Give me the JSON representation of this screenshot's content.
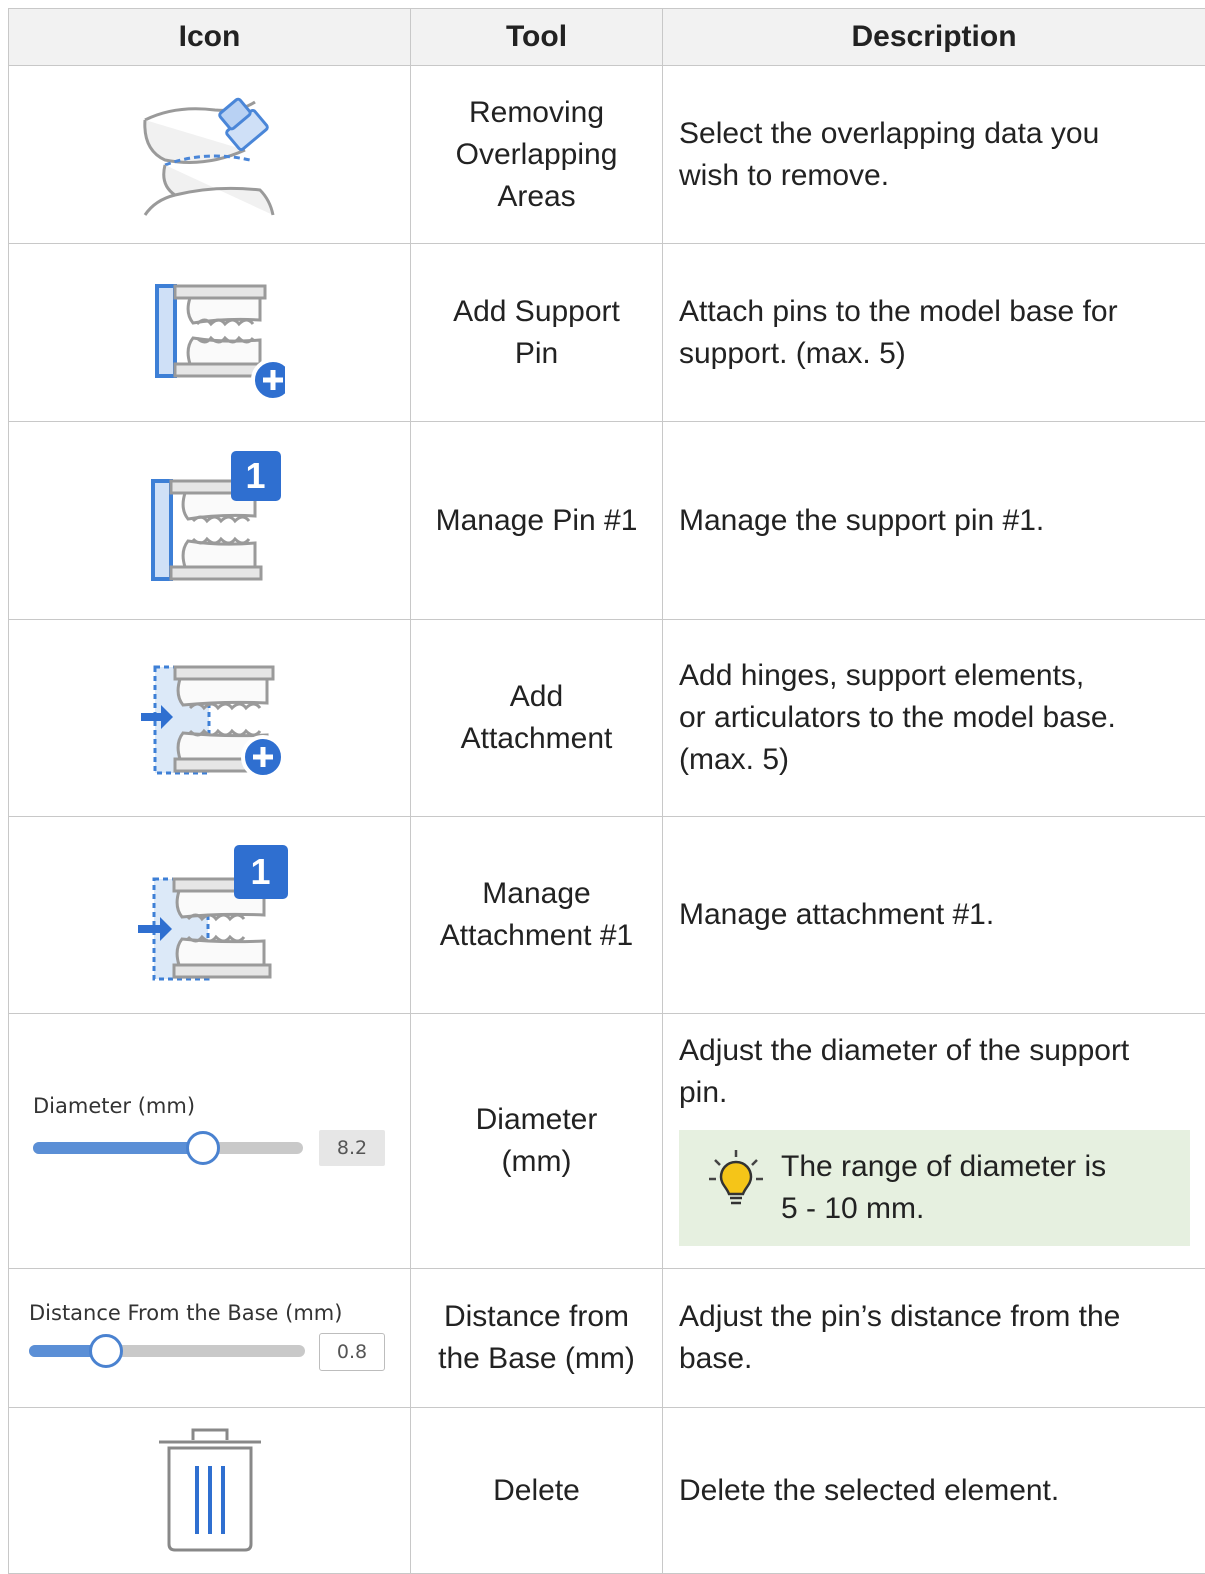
{
  "header": {
    "icon": "Icon",
    "tool": "Tool",
    "description": "Description"
  },
  "rows": [
    {
      "icon": "remove-overlap-icon",
      "tool": "Removing\nOverlapping\nAreas",
      "description": "Select the overlapping data you\nwish to remove."
    },
    {
      "icon": "add-support-pin-icon",
      "tool": "Add Support\nPin",
      "description": "Attach pins to the model base for\nsupport. (max. 5)"
    },
    {
      "icon": "manage-pin-icon",
      "badge": "1",
      "tool": "Manage Pin #1",
      "description": "Manage the support pin #1."
    },
    {
      "icon": "add-attachment-icon",
      "tool": "Add\nAttachment",
      "description": "Add hinges, support elements,\nor articulators to the model base.\n(max. 5)"
    },
    {
      "icon": "manage-attachment-icon",
      "badge": "1",
      "tool": "Manage\nAttachment #1",
      "description": "Manage attachment #1."
    },
    {
      "icon": "diameter-slider",
      "slider": {
        "label": "Diameter (mm)",
        "value": "8.2",
        "fraction": 0.63
      },
      "tool": "Diameter\n(mm)",
      "description": "Adjust the diameter of the support\npin.",
      "tip": {
        "icon": "lightbulb-icon",
        "text": "The range of diameter is\n5 - 10 mm."
      }
    },
    {
      "icon": "distance-slider",
      "slider": {
        "label": "Distance From the Base (mm)",
        "value": "0.8",
        "fraction": 0.28
      },
      "tool": "Distance from\nthe Base (mm)",
      "description": "Adjust the pin’s distance from the\nbase."
    },
    {
      "icon": "trash-icon",
      "tool": "Delete",
      "description": "Delete the selected element."
    }
  ],
  "colors": {
    "accent": "#2f7bd8",
    "icon_gray": "#9a9a9a",
    "tip_bg": "#e6f0e0",
    "bulb": "#f5c518"
  }
}
